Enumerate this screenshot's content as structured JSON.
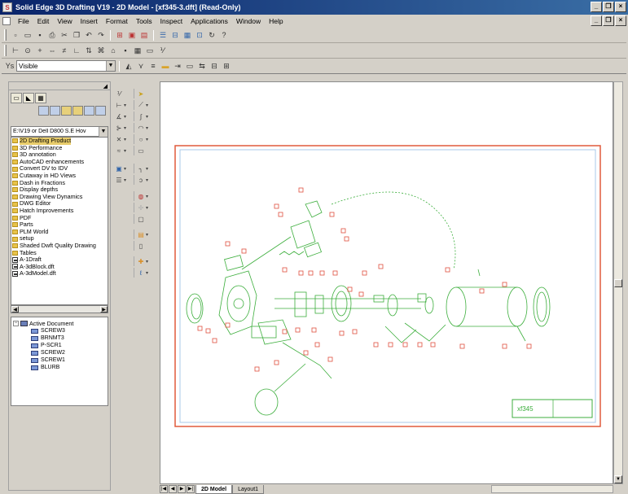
{
  "window": {
    "title": "Solid Edge 3D Drafting V19 - 2D Model - [xf345-3.dft] (Read-Only)",
    "minimize": "_",
    "restore": "❐",
    "close": "×"
  },
  "menu": {
    "items": [
      "File",
      "Edit",
      "View",
      "Insert",
      "Format",
      "Tools",
      "Inspect",
      "Applications",
      "Window",
      "Help"
    ]
  },
  "style_select": {
    "value": "Visible"
  },
  "left_panel": {
    "path": "E:\\V19 or Dell D800 S.E Hov",
    "files": [
      {
        "type": "folder",
        "name": "2D Drafting Product",
        "selected": true
      },
      {
        "type": "folder",
        "name": "3D Performance"
      },
      {
        "type": "folder",
        "name": "3D annotation"
      },
      {
        "type": "folder",
        "name": "AutoCAD enhancements"
      },
      {
        "type": "folder",
        "name": "Convert DV to IDV"
      },
      {
        "type": "folder",
        "name": "Cutaway in HD Views"
      },
      {
        "type": "folder",
        "name": "Dash in Fractions"
      },
      {
        "type": "folder",
        "name": "Display depths"
      },
      {
        "type": "folder",
        "name": "Drawing View Dynamics"
      },
      {
        "type": "folder",
        "name": "DWG Editor"
      },
      {
        "type": "folder",
        "name": "Hatch Improvements"
      },
      {
        "type": "folder",
        "name": "PDF"
      },
      {
        "type": "folder",
        "name": "Parts"
      },
      {
        "type": "folder",
        "name": "PLM World"
      },
      {
        "type": "folder",
        "name": "setup"
      },
      {
        "type": "folder",
        "name": "Shaded Dwft Quality Drawing"
      },
      {
        "type": "folder",
        "name": "Tables"
      },
      {
        "type": "file",
        "name": "A-1Draft"
      },
      {
        "type": "file",
        "name": "A-3dBlock.dft"
      },
      {
        "type": "file",
        "name": "A-3dModel.dft"
      }
    ],
    "tree_root": "Active Document",
    "tree_children": [
      "SCREW3",
      "BRNMT3",
      "P-SCR1",
      "SCREW2",
      "SCREW1",
      "BLURB"
    ]
  },
  "sheet_tabs": {
    "active": "2D Model",
    "other": "Layout1"
  },
  "drawing": {
    "title_block_text": "xf345"
  },
  "colors": {
    "border_red": "#e05a3c",
    "border_blue": "#a8c8e8",
    "geometry_green": "#3cae3c",
    "balloon_red": "#e05040",
    "title_bar_dark": "#0a246a"
  }
}
